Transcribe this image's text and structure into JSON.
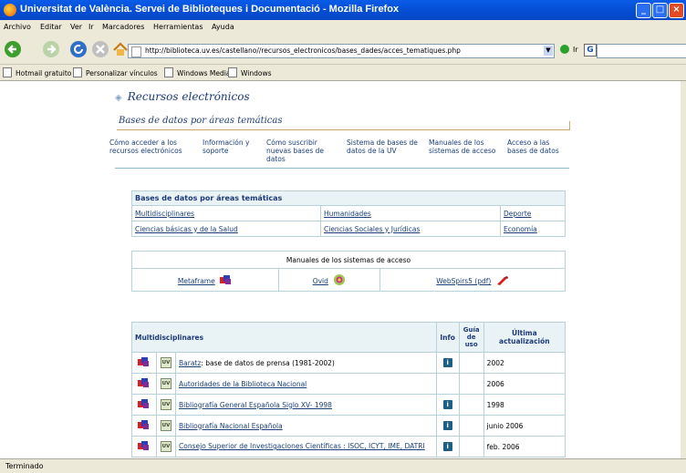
{
  "window": {
    "title": "Universitat de València. Servei de Biblioteques i Documentació - Mozilla Firefox"
  },
  "menu": [
    "Archivo",
    "Editar",
    "Ver",
    "Ir",
    "Marcadores",
    "Herramientas",
    "Ayuda"
  ],
  "toolbar": {
    "url": "http://biblioteca.uv.es/castellano//recursos_electronicos/bases_dades/acces_tematiques.php",
    "go_label": "Ir"
  },
  "bookmarks": [
    "Hotmail gratuito",
    "Personalizar vínculos",
    "Windows Media",
    "Windows"
  ],
  "status": "Terminado",
  "page": {
    "section_title": "Recursos electrónicos",
    "subtitle": "Bases de datos por áreas temáticas",
    "nav": [
      {
        "label": "Cómo acceder a los recursos electrónicos"
      },
      {
        "label": "Información y soporte"
      },
      {
        "label": "Cómo suscribir nuevas bases de datos"
      },
      {
        "label": "Sistema de bases de datos de la UV"
      },
      {
        "label": "Manuales de los sistemas de acceso"
      },
      {
        "label": "Acceso a las bases de datos"
      }
    ],
    "areas": {
      "header": "Bases de datos por áreas temáticas",
      "row1": [
        "Multidisciplinares",
        "Humanidades",
        "Deporte"
      ],
      "row2": [
        "Ciencias básicas y de la Salud",
        "Ciencias Sociales y Jurídicas",
        "Economía"
      ]
    },
    "manuals": {
      "header": "Manuales de los sistemas de acceso",
      "items": [
        "Metaframe",
        "Ovid",
        "WebSpirs5 (pdf)"
      ]
    },
    "db_table": {
      "headers": [
        "Multidisciplinares",
        "Info",
        "Guía de uso",
        "Última actualización"
      ],
      "uv_label": "UV",
      "info_label": "i",
      "rows": [
        {
          "name": "Baratz",
          "desc": ": base de datos de prensa (1981-2002)",
          "info": true,
          "updated": "2002"
        },
        {
          "name": "Autoridades de la Biblioteca Nacional",
          "desc": "",
          "info": false,
          "updated": "2006"
        },
        {
          "name": "Bibliografía General Española Siglo XV- 1998",
          "desc": "",
          "info": true,
          "updated": "1998"
        },
        {
          "name": "Bibliografía Nacional Española",
          "desc": "",
          "info": true,
          "updated": "junio 2006"
        },
        {
          "name": "Consejo Superior de Investigaciones Científicas : ISOC, ICYT, IME, DATRI",
          "desc": "",
          "info": true,
          "updated": "feb. 2006"
        }
      ]
    }
  }
}
